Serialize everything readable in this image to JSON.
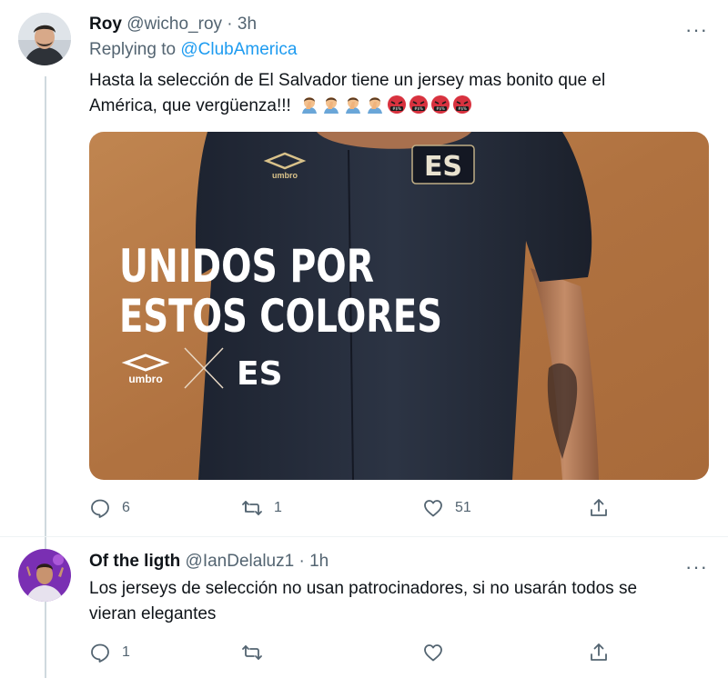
{
  "tweets": [
    {
      "name": "Roy",
      "handle": "@wicho_roy",
      "separator": "·",
      "time": "3h",
      "replying_prefix": "Replying to ",
      "replying_to": "@ClubAmerica",
      "text_line1": "Hasta la selección de El Salvador tiene un  jersey mas bonito que el",
      "text_line2": "América, que vergüenza!!!",
      "emojis": [
        "man-facepalming-icon",
        "man-facepalming-icon",
        "man-facepalming-icon",
        "man-facepalming-icon",
        "cursing-face-icon",
        "cursing-face-icon",
        "cursing-face-icon",
        "cursing-face-icon"
      ],
      "media": {
        "headline_line1": "UNIDOS POR",
        "headline_line2": "ESTOS COLORES",
        "umbro_label": "umbro",
        "crest_label": "ES",
        "shirt_brand": "umbro",
        "shirt_crest": "ES"
      },
      "reply_count": "6",
      "retweet_count": "1",
      "like_count": "51"
    },
    {
      "name": "Of the ligth",
      "handle": "@IanDelaluz1",
      "separator": "·",
      "time": "1h",
      "text_line1": "Los jerseys de selección no usan patrocinadores, si no usarán todos se",
      "text_line2": "vieran elegantes",
      "reply_count": "1",
      "retweet_count": "",
      "like_count": ""
    }
  ],
  "more_label": "···",
  "colors": {
    "accent": "#1d9bf0",
    "secondary": "#536471",
    "thread_line": "#cfd9de",
    "media_bg": "#b57a44"
  }
}
